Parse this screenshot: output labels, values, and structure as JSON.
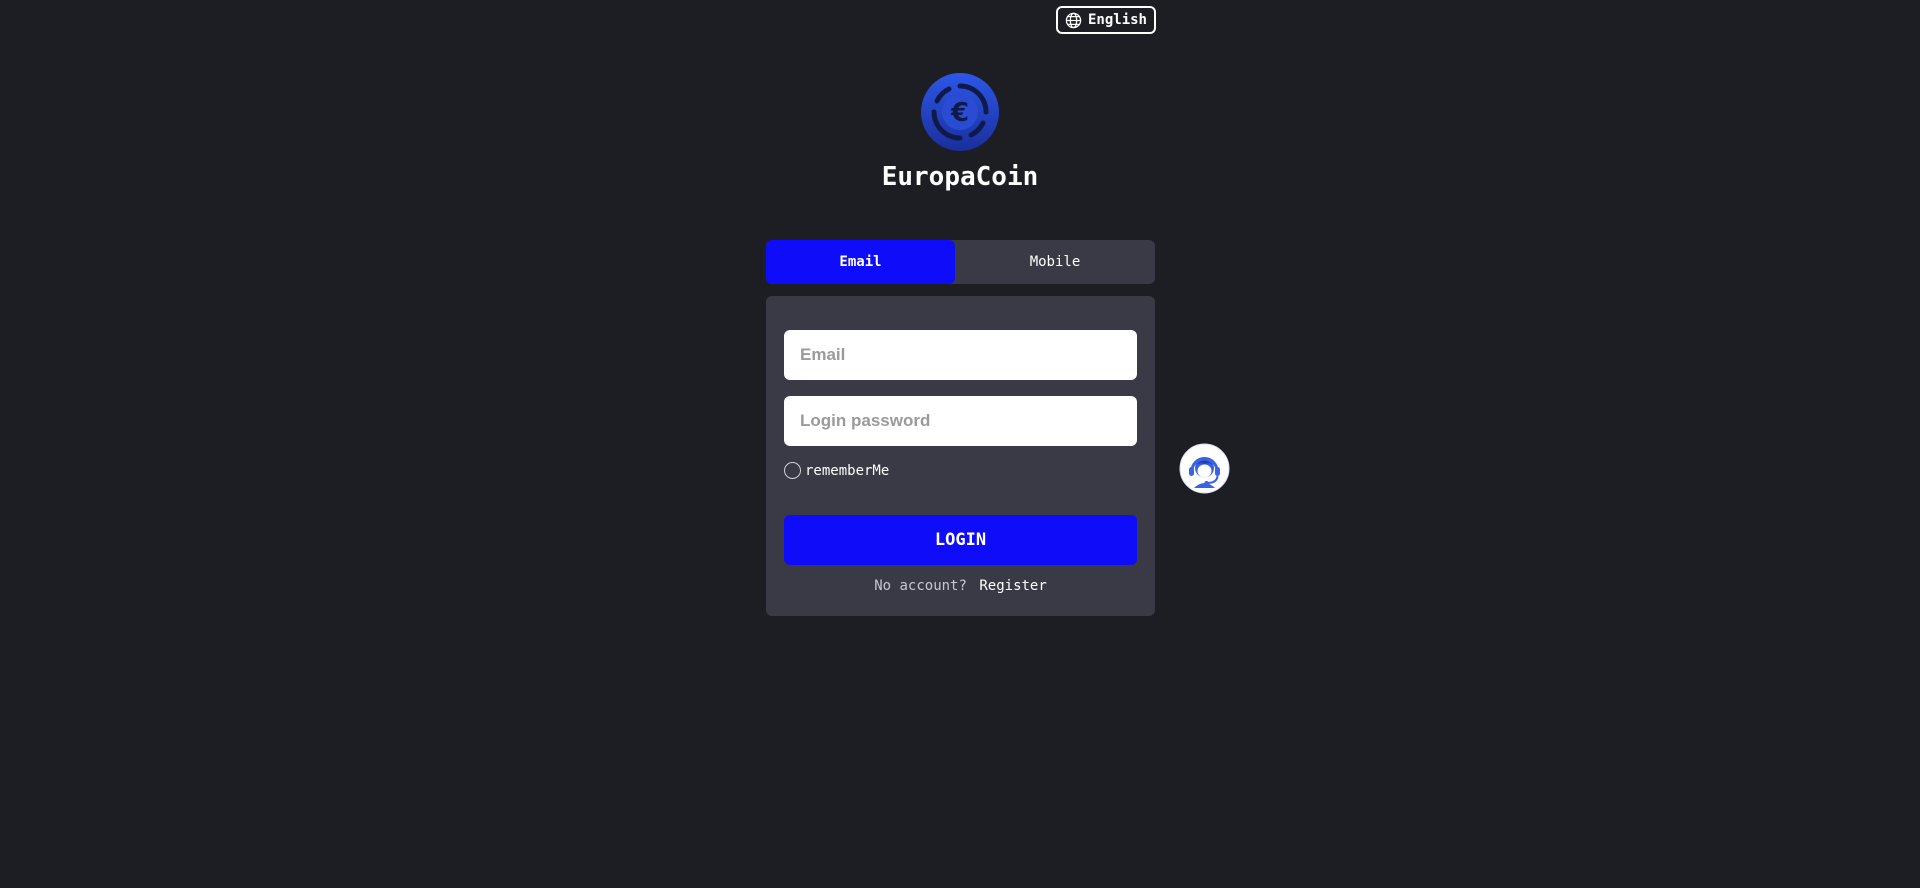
{
  "header": {
    "language_label": "English",
    "language_icon": "globe-icon"
  },
  "brand": {
    "logo_icon": "euro-coin-icon",
    "name": "EuropaCoin"
  },
  "tabs": [
    {
      "label": "Email",
      "active": true
    },
    {
      "label": "Mobile",
      "active": false
    }
  ],
  "form": {
    "email_placeholder": "Email",
    "email_value": "",
    "password_placeholder": "Login password",
    "password_value": "",
    "remember_label": "rememberMe",
    "remember_checked": false,
    "login_label": "LOGIN",
    "register_prompt": "No account?",
    "register_link": "Register"
  },
  "support": {
    "icon": "customer-support-icon"
  },
  "colors": {
    "background": "#1d1e23",
    "panel": "#3a3946",
    "accent": "#0f0cf9",
    "logo_blue": "#2647d6"
  }
}
